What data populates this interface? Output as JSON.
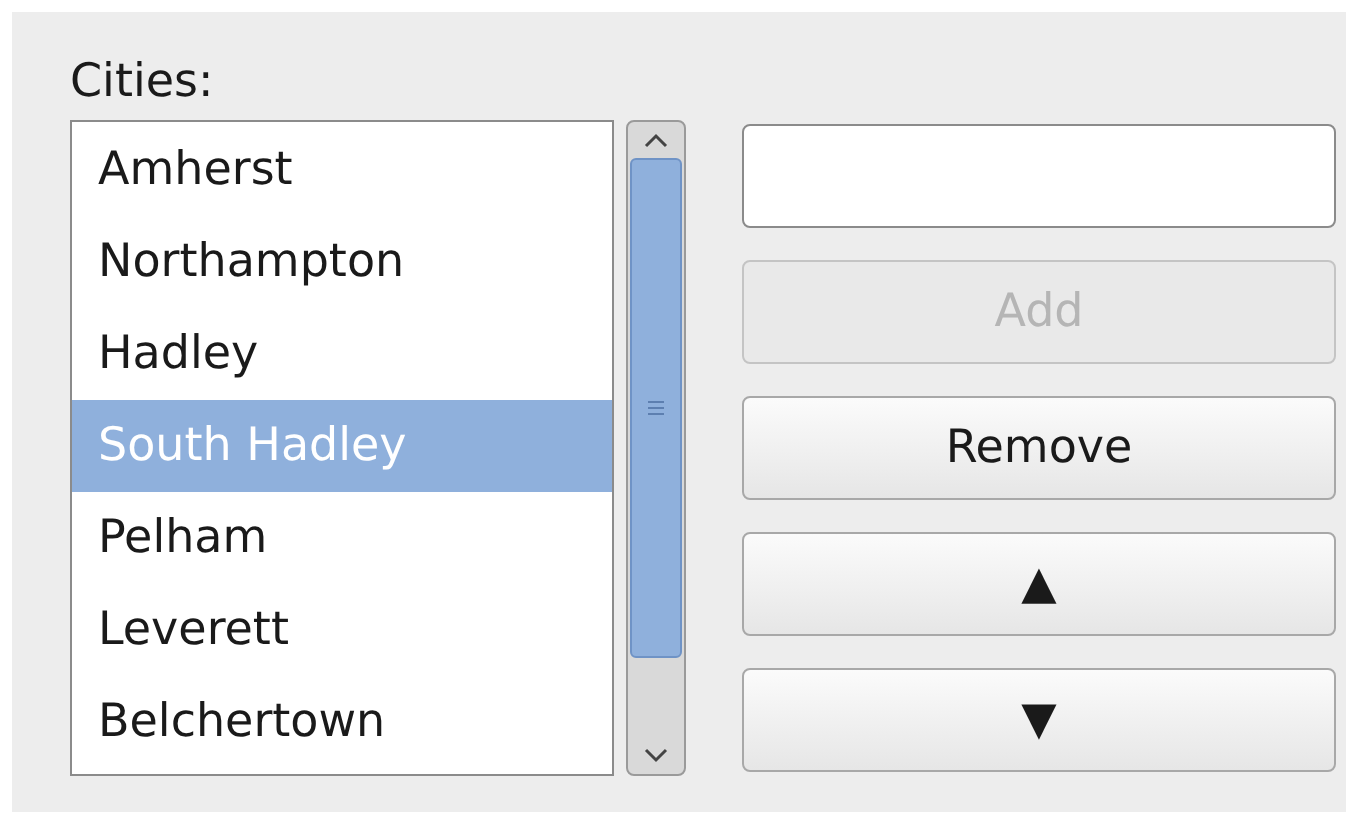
{
  "label": "Cities:",
  "cities": [
    {
      "name": "Amherst",
      "selected": false
    },
    {
      "name": "Northampton",
      "selected": false
    },
    {
      "name": "Hadley",
      "selected": false
    },
    {
      "name": "South Hadley",
      "selected": true
    },
    {
      "name": "Pelham",
      "selected": false
    },
    {
      "name": "Leverett",
      "selected": false
    },
    {
      "name": "Belchertown",
      "selected": false
    }
  ],
  "buttons": [
    {
      "label": "Add",
      "disabled": true
    },
    {
      "label": "Remove",
      "disabled": false
    },
    {
      "label": "▲",
      "disabled": false
    },
    {
      "label": "▼",
      "disabled": false
    }
  ]
}
